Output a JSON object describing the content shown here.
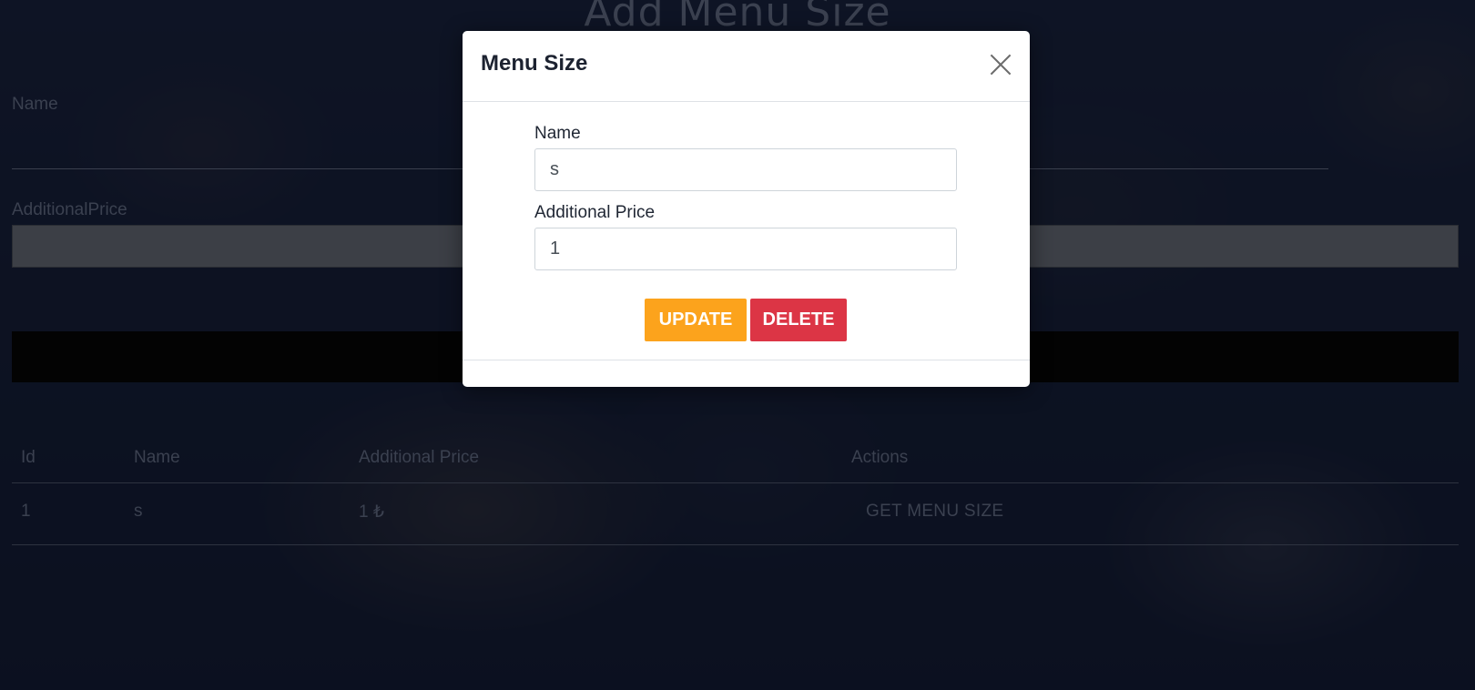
{
  "page": {
    "title": "Add Menu Size",
    "form": {
      "name_label": "Name",
      "price_label": "AdditionalPrice"
    },
    "table": {
      "headers": [
        "Id",
        "Name",
        "Additional Price",
        "Actions"
      ],
      "rows": [
        {
          "id": "1",
          "name": "s",
          "price": "1 ₺",
          "action": "GET MENU SIZE"
        }
      ]
    }
  },
  "modal": {
    "title": "Menu Size",
    "name_label": "Name",
    "name_value": "s",
    "price_label": "Additional Price",
    "price_value": "1",
    "update_label": "UPDATE",
    "delete_label": "DELETE"
  },
  "colors": {
    "update": "#fca31c",
    "delete": "#dc3545"
  }
}
